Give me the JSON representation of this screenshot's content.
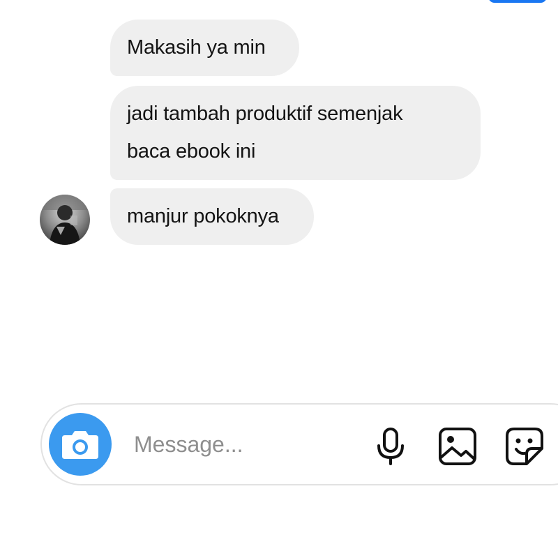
{
  "conversation": {
    "messages": [
      {
        "lines": [
          "Makasih ya min"
        ]
      },
      {
        "lines": [
          "jadi tambah produktif semenjak",
          "baca ebook ini"
        ]
      },
      {
        "lines": [
          "manjur pokoknya"
        ]
      }
    ]
  },
  "composer": {
    "placeholder": "Message...",
    "value": ""
  },
  "icons": {
    "camera": "camera-icon",
    "microphone": "microphone-icon",
    "gallery": "image-icon",
    "sticker": "sticker-icon"
  },
  "colors": {
    "bubble_background": "#efefef",
    "accent": "#3b9aef",
    "top_button": "#1a77f2",
    "composer_border": "#e2e2e2",
    "placeholder": "#8e8e8e"
  }
}
